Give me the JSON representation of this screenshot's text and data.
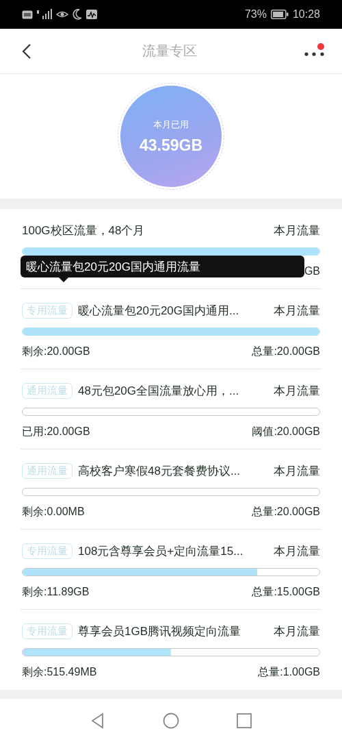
{
  "status_bar": {
    "battery_text": "73%",
    "time": "10:28"
  },
  "header": {
    "title": "流量专区",
    "notification_dot": true
  },
  "usage": {
    "label": "本月已用",
    "value": "43.59GB"
  },
  "packages": [
    {
      "title": "100G校区流量，48个月",
      "period": "本月流量",
      "level": 1,
      "right_text": "GB",
      "tooltip": "暖心流量包20元20G国内通用流量"
    },
    {
      "tag": "专用流量",
      "title": "暖心流量包20元20G国内通用...",
      "period": "本月流量",
      "level": 1,
      "left_text": "剩余:20.00GB",
      "right_text": "总量:20.00GB"
    },
    {
      "tag": "通用流量",
      "title": "48元包20G全国流量放心用，...",
      "period": "本月流量",
      "level": 0,
      "left_text": "已用:20.00GB",
      "right_text": "阈值:20.00GB"
    },
    {
      "tag": "通用流量",
      "title": "高校客户寒假48元套餐费协议...",
      "period": "本月流量",
      "level": 0,
      "left_text": "剩余:0.00MB",
      "right_text": "总量:20.00GB"
    },
    {
      "tag": "专用流量",
      "title": "108元含尊享会员+定向流量15...",
      "period": "本月流量",
      "level": 0.79,
      "left_text": "剩余:11.89GB",
      "right_text": "总量:15.00GB"
    },
    {
      "tag": "专用流量",
      "title": "尊享会员1GB腾讯视频定向流量",
      "period": "本月流量",
      "level": 0.5,
      "left_text": "剩余:515.49MB",
      "right_text": "总量:1.00GB"
    }
  ]
}
